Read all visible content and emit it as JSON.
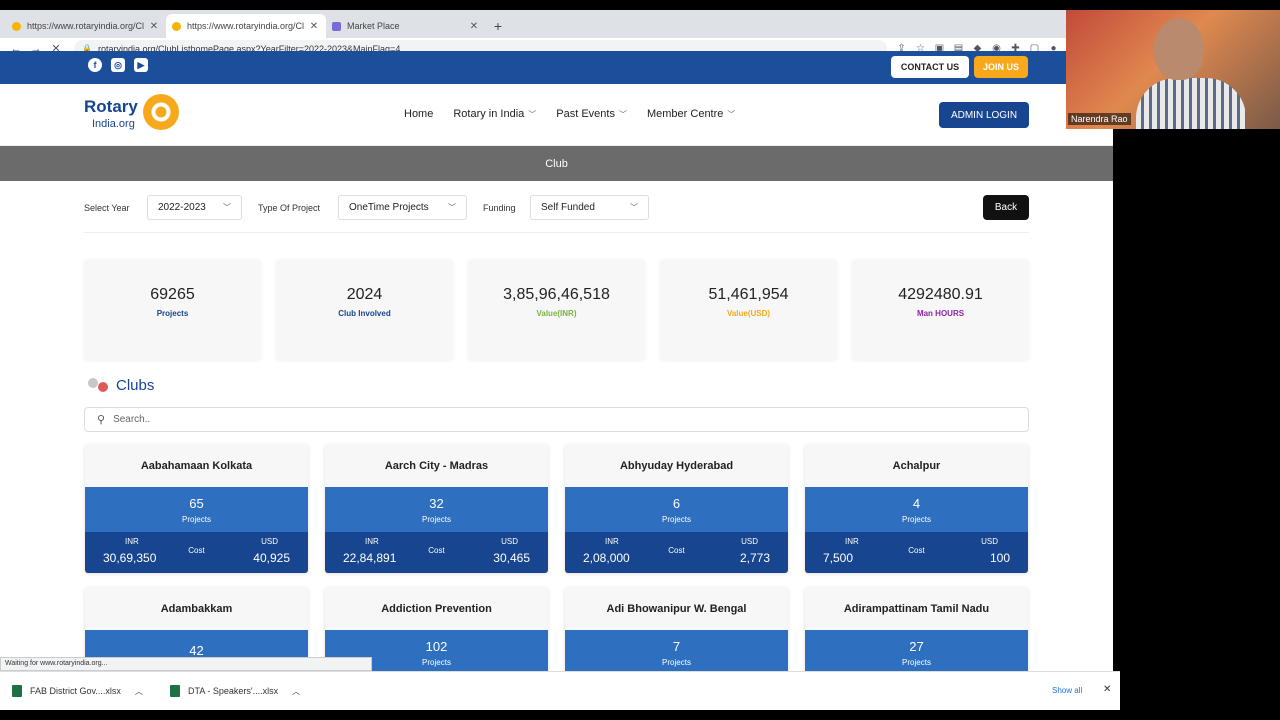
{
  "browser": {
    "tabs": [
      {
        "title": "https://www.rotaryindia.org/Cl",
        "active": false
      },
      {
        "title": "https://www.rotaryindia.org/Cl",
        "active": true
      },
      {
        "title": "Market Place",
        "active": false
      }
    ],
    "url": "rotaryindia.org/ClubListhomePage.aspx?YearFilter=2022-2023&MainFlag=4",
    "status": "Waiting for www.rotaryindia.org..."
  },
  "site": {
    "contact": "CONTACT US",
    "join": "JOIN US",
    "logo_rotary": "Rotary",
    "logo_org": "India.org",
    "menu": [
      "Home",
      "Rotary in India",
      "Past Events",
      "Member Centre"
    ],
    "admin": "ADMIN LOGIN",
    "section": "Club",
    "filters": {
      "year_label": "Select Year",
      "year_value": "2022-2023",
      "type_label": "Type Of Project",
      "type_value": "OneTime Projects",
      "funding_label": "Funding",
      "funding_value": "Self Funded",
      "back": "Back"
    },
    "stats": [
      {
        "value": "69265",
        "label": "Projects",
        "color": "#17458f"
      },
      {
        "value": "2024",
        "label": "Club Involved",
        "color": "#17458f"
      },
      {
        "value": "3,85,96,46,518",
        "label": "Value(INR)",
        "color": "#7cb342"
      },
      {
        "value": "51,461,954",
        "label": "Value(USD)",
        "color": "#f7a81b"
      },
      {
        "value": "4292480.91",
        "label": "Man HOURS",
        "color": "#8e24aa"
      }
    ],
    "clubs_title": "Clubs",
    "search_placeholder": "Search..",
    "cards": [
      {
        "name": "Aabahamaan Kolkata",
        "count": "65",
        "unit": "Projects",
        "inr_label": "INR",
        "inr": "30,69,350",
        "cost": "Cost",
        "usd_label": "USD",
        "usd": "40,925"
      },
      {
        "name": "Aarch City - Madras",
        "count": "32",
        "unit": "Projects",
        "inr_label": "INR",
        "inr": "22,84,891",
        "cost": "Cost",
        "usd_label": "USD",
        "usd": "30,465"
      },
      {
        "name": "Abhyuday Hyderabad",
        "count": "6",
        "unit": "Projects",
        "inr_label": "INR",
        "inr": "2,08,000",
        "cost": "Cost",
        "usd_label": "USD",
        "usd": "2,773"
      },
      {
        "name": "Achalpur",
        "count": "4",
        "unit": "Projects",
        "inr_label": "INR",
        "inr": "7,500",
        "cost": "Cost",
        "usd_label": "USD",
        "usd": "100"
      },
      {
        "name": "Adambakkam",
        "count": "42",
        "unit": "",
        "inr_label": "",
        "inr": "",
        "cost": "",
        "usd_label": "",
        "usd": ""
      },
      {
        "name": "Addiction Prevention",
        "count": "102",
        "unit": "Projects",
        "inr_label": "",
        "inr": "",
        "cost": "",
        "usd_label": "",
        "usd": ""
      },
      {
        "name": "Adi Bhowanipur W. Bengal",
        "count": "7",
        "unit": "Projects",
        "inr_label": "",
        "inr": "",
        "cost": "",
        "usd_label": "",
        "usd": ""
      },
      {
        "name": "Adirampattinam Tamil Nadu",
        "count": "27",
        "unit": "Projects",
        "inr_label": "",
        "inr": "",
        "cost": "",
        "usd_label": "",
        "usd": ""
      }
    ]
  },
  "downloads": {
    "items": [
      "FAB District Gov....xlsx",
      "DTA - Speakers'....xlsx"
    ],
    "show_all": "Show all"
  },
  "video": {
    "name": "Narendra Rao"
  }
}
